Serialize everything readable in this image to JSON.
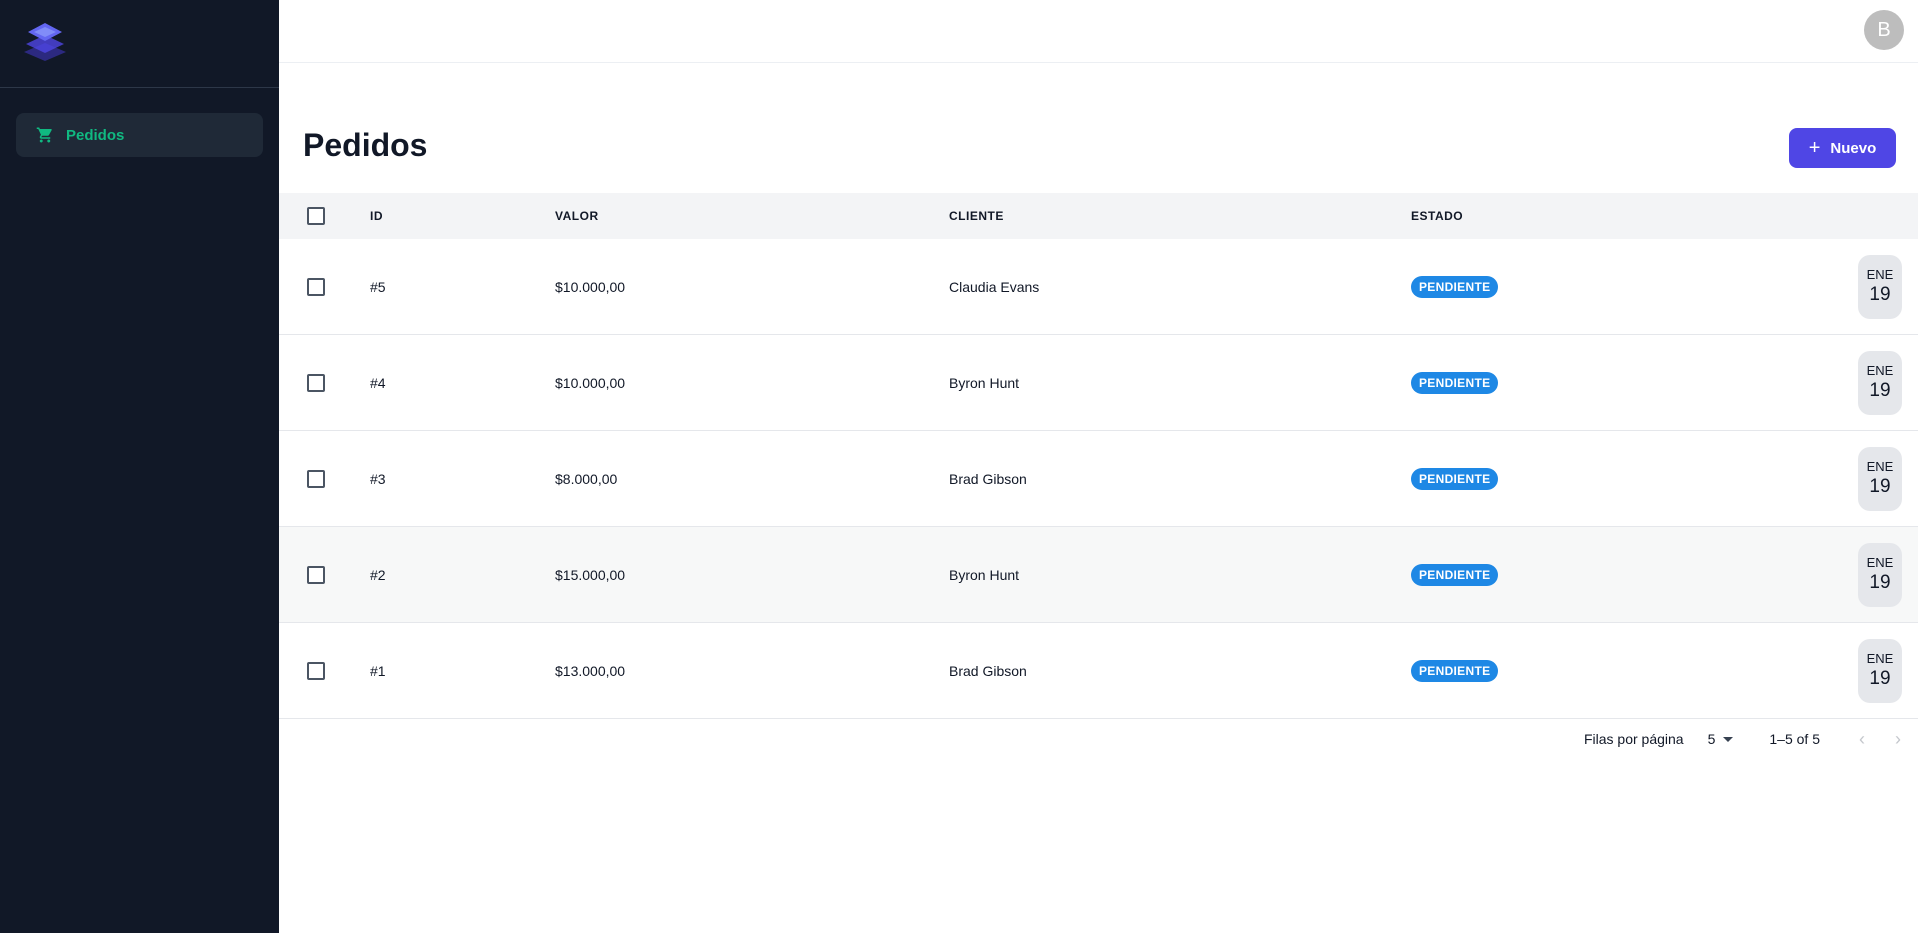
{
  "sidebar": {
    "items": [
      {
        "label": "Pedidos",
        "icon": "cart-icon"
      }
    ]
  },
  "header": {
    "avatar_initial": "B"
  },
  "page": {
    "title": "Pedidos",
    "new_button_label": "Nuevo"
  },
  "table": {
    "columns": [
      "ID",
      "VALOR",
      "CLIENTE",
      "ESTADO"
    ],
    "rows": [
      {
        "id": "#5",
        "valor": "$10.000,00",
        "cliente": "Claudia Evans",
        "estado": "PENDIENTE",
        "month": "ENE",
        "day": "19"
      },
      {
        "id": "#4",
        "valor": "$10.000,00",
        "cliente": "Byron Hunt",
        "estado": "PENDIENTE",
        "month": "ENE",
        "day": "19"
      },
      {
        "id": "#3",
        "valor": "$8.000,00",
        "cliente": "Brad Gibson",
        "estado": "PENDIENTE",
        "month": "ENE",
        "day": "19"
      },
      {
        "id": "#2",
        "valor": "$15.000,00",
        "cliente": "Byron Hunt",
        "estado": "PENDIENTE",
        "month": "ENE",
        "day": "19"
      },
      {
        "id": "#1",
        "valor": "$13.000,00",
        "cliente": "Brad Gibson",
        "estado": "PENDIENTE",
        "month": "ENE",
        "day": "19"
      }
    ]
  },
  "pagination": {
    "rows_per_page_label": "Filas por página",
    "rows_per_page_value": "5",
    "range": "1–5 of 5"
  },
  "colors": {
    "sidebar_bg": "#111827",
    "accent": "#10b981",
    "primary": "#4f46e5",
    "badge": "#1e88e5"
  }
}
